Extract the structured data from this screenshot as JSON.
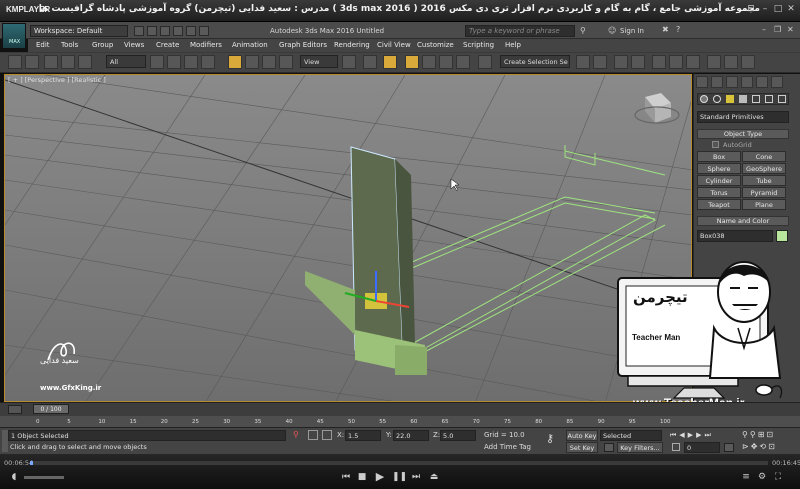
{
  "player": {
    "name": "KMPLAYER",
    "caption": "مجموعه آموزشی جامع ، گام به گام و کاربردی نرم افزار تری دی مکس 2016 ( 3ds max 2016 )   مدرس : سعید فدایی (تیچرمن) گروه آموزشی پادشاه گرافیست ها",
    "time_elapsed": "00:06:54",
    "time_total": "00:16:45"
  },
  "app": {
    "title": "Autodesk 3ds Max 2016    Untitled",
    "logo_label": "MAX",
    "workspace_label": "Workspace: Default",
    "search_placeholder": "Type a keyword or phrase",
    "sign_in": "Sign In"
  },
  "menu": [
    "Edit",
    "Tools",
    "Group",
    "Views",
    "Create",
    "Modifiers",
    "Animation",
    "Graph Editors",
    "Rendering",
    "Civil View",
    "Customize",
    "Scripting",
    "Help"
  ],
  "toolbar": {
    "filter_value": "All",
    "ref_coord_value": "View",
    "selection_set_placeholder": "Create Selection Se"
  },
  "viewport": {
    "label": "[ + ] [Perspective ] [Realistic ]"
  },
  "command_panel": {
    "category_value": "Standard Primitives",
    "object_type_title": "Object Type",
    "autogrid_label": "AutoGrid",
    "buttons": [
      "Box",
      "Cone",
      "Sphere",
      "GeoSphere",
      "Cylinder",
      "Tube",
      "Torus",
      "Pyramid",
      "Teapot",
      "Plane"
    ],
    "name_color_title": "Name and Color",
    "object_name": "Box038",
    "object_color": "#b7e69c"
  },
  "timeline": {
    "slider_label": "0 / 100",
    "ticks": [
      "0",
      "5",
      "10",
      "15",
      "20",
      "25",
      "30",
      "35",
      "40",
      "45",
      "50",
      "55",
      "60",
      "65",
      "70",
      "75",
      "80",
      "85",
      "90",
      "95",
      "100"
    ]
  },
  "status": {
    "selection": "1 Object Selected",
    "prompt": "Click and drag to select and move objects",
    "x_label": "X:",
    "x_value": "1.5",
    "y_label": "Y:",
    "y_value": "22.0",
    "z_label": "Z:",
    "z_value": "5.0",
    "grid": "Grid = 10.0",
    "add_time_tag": "Add Time Tag",
    "auto_key": "Auto Key",
    "set_key": "Set Key",
    "key_mode_value": "Selected",
    "key_filters": "Key Filters...",
    "frame_value": "0"
  },
  "watermarks": {
    "author_name": "سعید فدایی",
    "site_small": "www.GfxKing.ir",
    "teacherman_url": "www.TeacherMan.ir",
    "teacherman_label": "Teacher Man",
    "teacherman_logo": "تیچرمن"
  }
}
